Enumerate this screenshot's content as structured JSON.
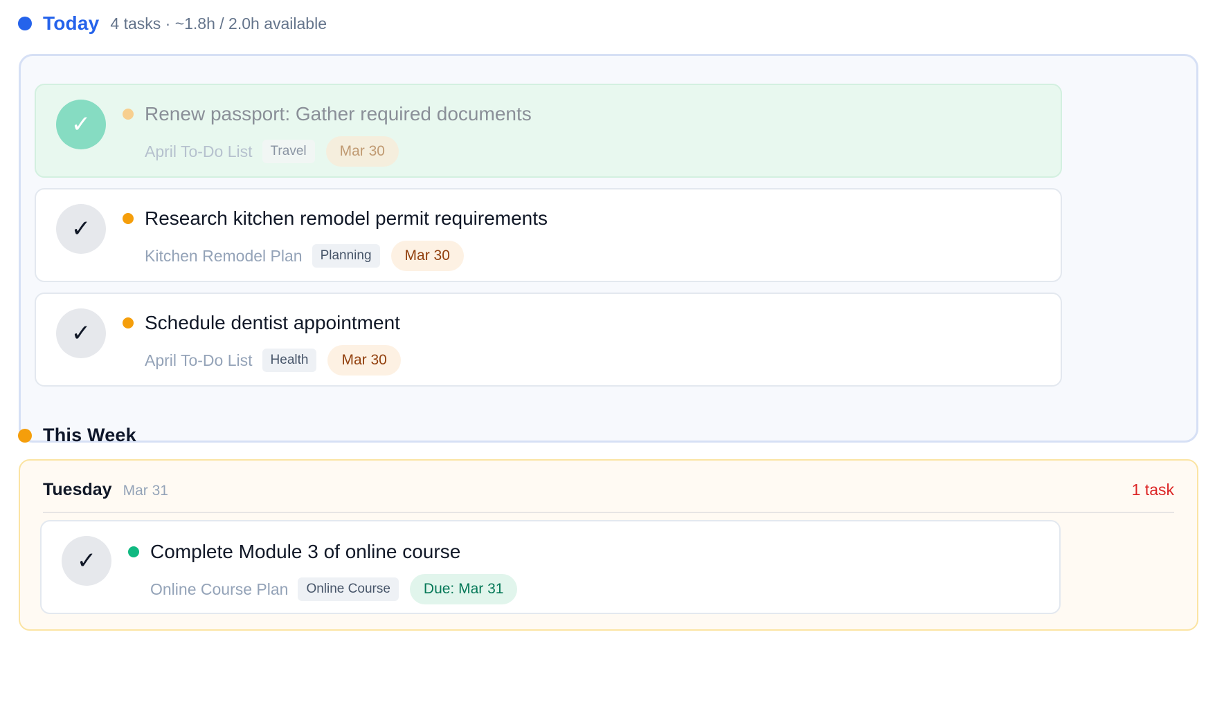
{
  "today": {
    "title": "Today",
    "meta": "4 tasks · ~1.8h / 2.0h available",
    "dot_color": "#2563eb",
    "title_color": "#2563eb",
    "tasks": [
      {
        "title": "Renew passport: Gather required documents",
        "project": "April To-Do List",
        "tag": "Travel",
        "date": "Mar 30",
        "completed": true,
        "priority_color": "#f7cf8f",
        "check": "✓"
      },
      {
        "title": "Research kitchen remodel permit requirements",
        "project": "Kitchen Remodel Plan",
        "tag": "Planning",
        "date": "Mar 30",
        "completed": false,
        "priority_color": "#f59e0b",
        "check": "✓"
      },
      {
        "title": "Schedule dentist appointment",
        "project": "April To-Do List",
        "tag": "Health",
        "date": "Mar 30",
        "completed": false,
        "priority_color": "#f59e0b",
        "check": "✓"
      }
    ]
  },
  "this_week": {
    "title": "This Week",
    "dot_color": "#f59e0b",
    "days": [
      {
        "name": "Tuesday",
        "date": "Mar 31",
        "count": "1 task",
        "tasks": [
          {
            "title": "Complete Module 3 of online course",
            "project": "Online Course Plan",
            "tag": "Online Course",
            "date": "Due: Mar 31",
            "completed": false,
            "priority_color": "#10b981",
            "check": "✓"
          }
        ]
      }
    ]
  }
}
